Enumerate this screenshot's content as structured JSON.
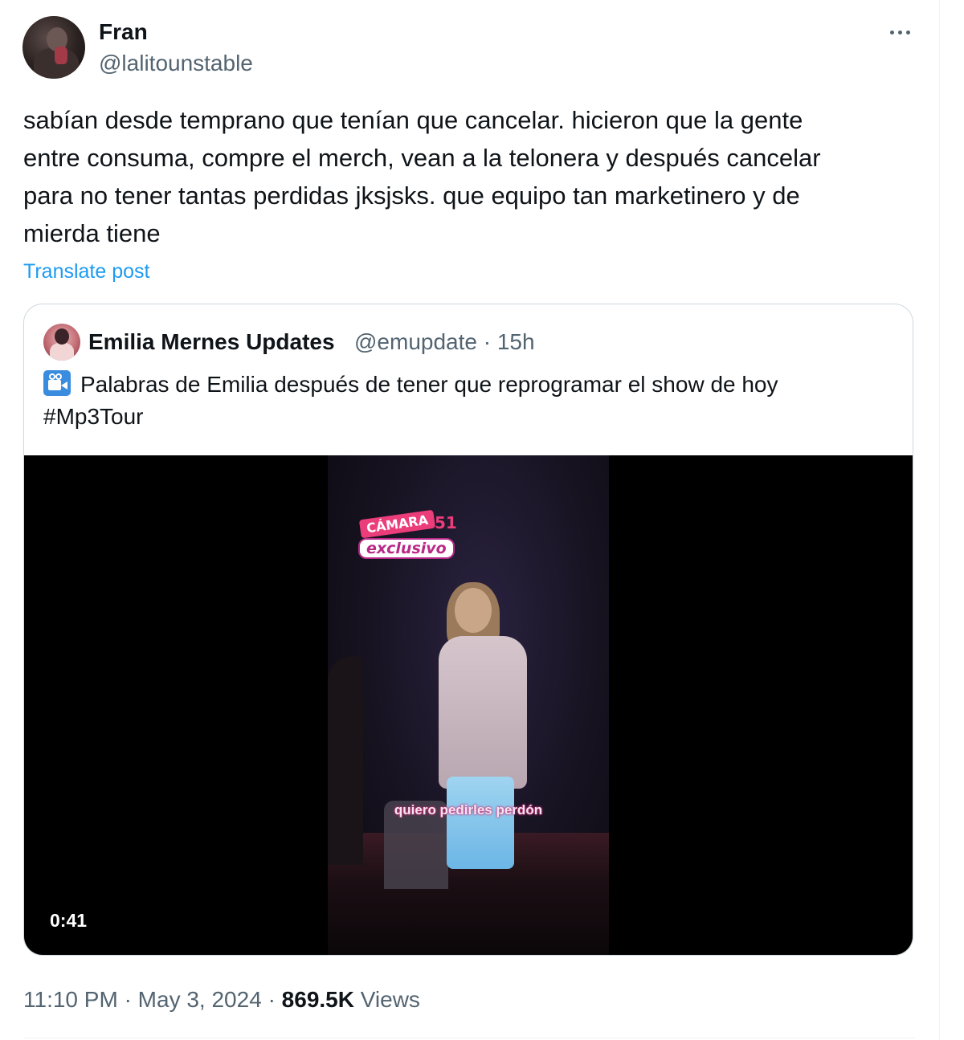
{
  "author": {
    "display_name": "Fran",
    "handle": "@lalitounstable"
  },
  "more_icon": "more-horizontal-icon",
  "post": {
    "text": "sabían desde temprano que tenían que cancelar. hicieron que la gente\nentre consuma, compre el merch, vean a la telonera y después cancelar\npara no tener tantas perdidas jksjsks. que equipo tan marketinero y de\nmierda tiene",
    "translate_label": "Translate post"
  },
  "quote": {
    "display_name": "Emilia Mernes Updates",
    "handle_time": "@emupdate · 15h",
    "icon": "movie-camera-icon",
    "text": "Palabras de Emilia después de tener que reprogramar el show de hoy",
    "hashtag": "#Mp3Tour",
    "video": {
      "logo_camara": "CÁMARA",
      "logo_number": "51",
      "logo_exclusivo": "exclusivo",
      "subtitle": "quiero pedirles perdón",
      "duration": "0:41"
    }
  },
  "meta": {
    "time": "11:10 PM",
    "separator": "·",
    "date": "May 3, 2024",
    "views_count": "869.5K",
    "views_label": "Views"
  },
  "colors": {
    "link": "#1d9bf0",
    "secondary_text": "#536471",
    "primary_text": "#0f1419",
    "border": "#cfd9de"
  }
}
